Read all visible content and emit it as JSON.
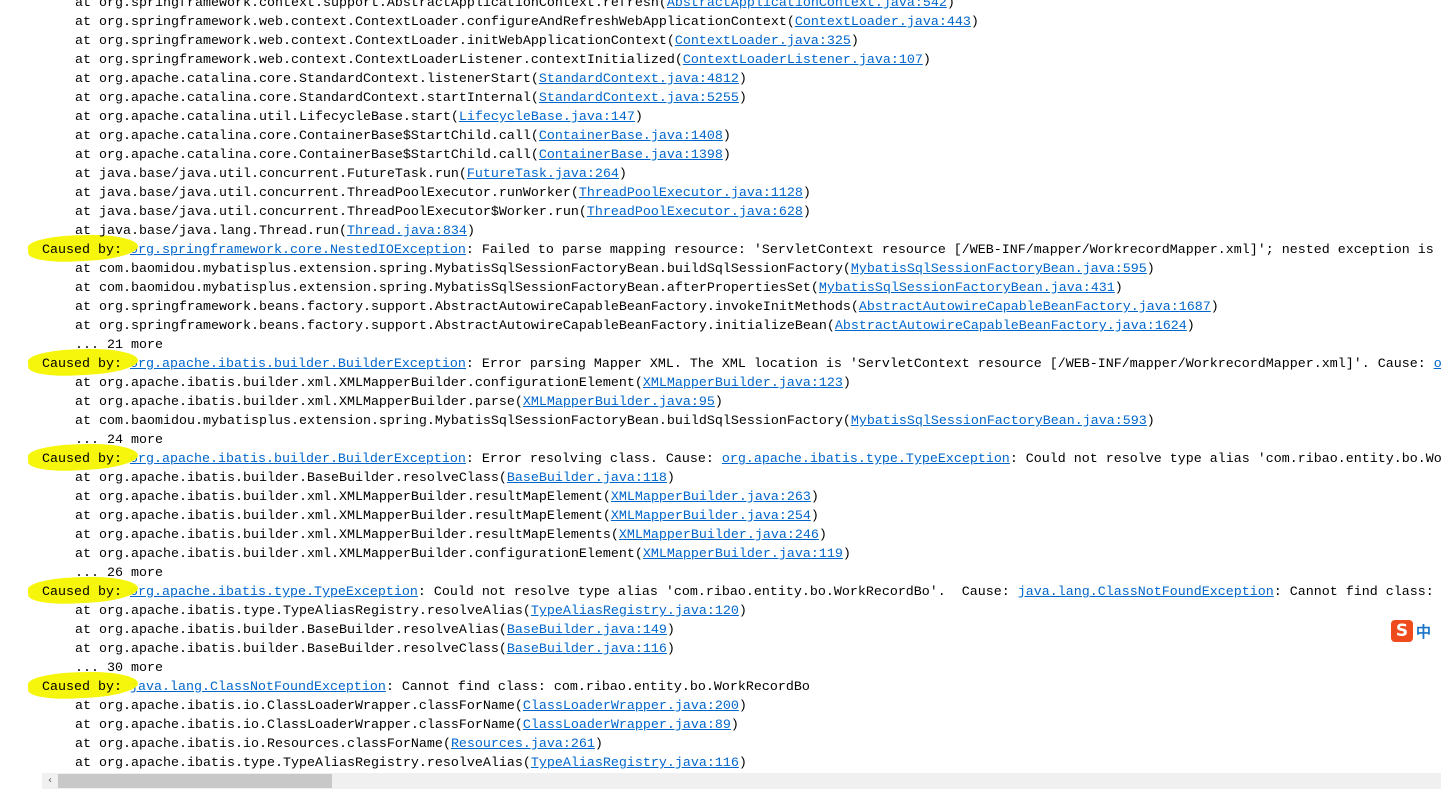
{
  "labels": {
    "at": "at ",
    "caused": "Caused by: "
  },
  "lines": [
    {
      "k": "at",
      "m": "org.springframework.context.support.AbstractApplicationContext.refresh",
      "src": "AbstractApplicationContext.java:542"
    },
    {
      "k": "at",
      "m": "org.springframework.web.context.ContextLoader.configureAndRefreshWebApplicationContext",
      "src": "ContextLoader.java:443"
    },
    {
      "k": "at",
      "m": "org.springframework.web.context.ContextLoader.initWebApplicationContext",
      "src": "ContextLoader.java:325"
    },
    {
      "k": "at",
      "m": "org.springframework.web.context.ContextLoaderListener.contextInitialized",
      "src": "ContextLoaderListener.java:107"
    },
    {
      "k": "at",
      "m": "org.apache.catalina.core.StandardContext.listenerStart",
      "src": "StandardContext.java:4812"
    },
    {
      "k": "at",
      "m": "org.apache.catalina.core.StandardContext.startInternal",
      "src": "StandardContext.java:5255"
    },
    {
      "k": "at",
      "m": "org.apache.catalina.util.LifecycleBase.start",
      "src": "LifecycleBase.java:147"
    },
    {
      "k": "at",
      "m": "org.apache.catalina.core.ContainerBase$StartChild.call",
      "src": "ContainerBase.java:1408"
    },
    {
      "k": "at",
      "m": "org.apache.catalina.core.ContainerBase$StartChild.call",
      "src": "ContainerBase.java:1398"
    },
    {
      "k": "at",
      "m": "java.base/java.util.concurrent.FutureTask.run",
      "src": "FutureTask.java:264"
    },
    {
      "k": "at",
      "m": "java.base/java.util.concurrent.ThreadPoolExecutor.runWorker",
      "src": "ThreadPoolExecutor.java:1128"
    },
    {
      "k": "at",
      "m": "java.base/java.util.concurrent.ThreadPoolExecutor$Worker.run",
      "src": "ThreadPoolExecutor.java:628"
    },
    {
      "k": "at",
      "m": "java.base/java.lang.Thread.run",
      "src": "Thread.java:834"
    },
    {
      "k": "caused",
      "segs": [
        {
          "t": "org.springframework.core.NestedIOException",
          "l": true
        },
        {
          "t": ": Failed to parse mapping resource: 'ServletContext resource [/WEB-INF/mapper/WorkrecordMapper.xml]'; nested exception is"
        }
      ]
    },
    {
      "k": "at",
      "m": "com.baomidou.mybatisplus.extension.spring.MybatisSqlSessionFactoryBean.buildSqlSessionFactory",
      "src": "MybatisSqlSessionFactoryBean.java:595"
    },
    {
      "k": "at",
      "m": "com.baomidou.mybatisplus.extension.spring.MybatisSqlSessionFactoryBean.afterPropertiesSet",
      "src": "MybatisSqlSessionFactoryBean.java:431"
    },
    {
      "k": "at",
      "m": "org.springframework.beans.factory.support.AbstractAutowireCapableBeanFactory.invokeInitMethods",
      "src": "AbstractAutowireCapableBeanFactory.java:1687"
    },
    {
      "k": "at",
      "m": "org.springframework.beans.factory.support.AbstractAutowireCapableBeanFactory.initializeBean",
      "src": "AbstractAutowireCapableBeanFactory.java:1624"
    },
    {
      "k": "more",
      "t": "... 21 more"
    },
    {
      "k": "caused",
      "segs": [
        {
          "t": "org.apache.ibatis.builder.BuilderException",
          "l": true
        },
        {
          "t": ": Error parsing Mapper XML. The XML location is 'ServletContext resource [/WEB-INF/mapper/WorkrecordMapper.xml]'. Cause: "
        },
        {
          "t": "o",
          "l": true
        }
      ]
    },
    {
      "k": "at",
      "m": "org.apache.ibatis.builder.xml.XMLMapperBuilder.configurationElement",
      "src": "XMLMapperBuilder.java:123"
    },
    {
      "k": "at",
      "m": "org.apache.ibatis.builder.xml.XMLMapperBuilder.parse",
      "src": "XMLMapperBuilder.java:95"
    },
    {
      "k": "at",
      "m": "com.baomidou.mybatisplus.extension.spring.MybatisSqlSessionFactoryBean.buildSqlSessionFactory",
      "src": "MybatisSqlSessionFactoryBean.java:593"
    },
    {
      "k": "more",
      "t": "... 24 more"
    },
    {
      "k": "caused",
      "segs": [
        {
          "t": "org.apache.ibatis.builder.BuilderException",
          "l": true
        },
        {
          "t": ": Error resolving class. Cause: "
        },
        {
          "t": "org.apache.ibatis.type.TypeException",
          "l": true
        },
        {
          "t": ": Could not resolve type alias 'com.ribao.entity.bo.Wo"
        }
      ]
    },
    {
      "k": "at",
      "m": "org.apache.ibatis.builder.BaseBuilder.resolveClass",
      "src": "BaseBuilder.java:118"
    },
    {
      "k": "at",
      "m": "org.apache.ibatis.builder.xml.XMLMapperBuilder.resultMapElement",
      "src": "XMLMapperBuilder.java:263"
    },
    {
      "k": "at",
      "m": "org.apache.ibatis.builder.xml.XMLMapperBuilder.resultMapElement",
      "src": "XMLMapperBuilder.java:254"
    },
    {
      "k": "at",
      "m": "org.apache.ibatis.builder.xml.XMLMapperBuilder.resultMapElements",
      "src": "XMLMapperBuilder.java:246"
    },
    {
      "k": "at",
      "m": "org.apache.ibatis.builder.xml.XMLMapperBuilder.configurationElement",
      "src": "XMLMapperBuilder.java:119"
    },
    {
      "k": "more",
      "t": "... 26 more"
    },
    {
      "k": "caused",
      "segs": [
        {
          "t": "org.apache.ibatis.type.TypeException",
          "l": true
        },
        {
          "t": ": Could not resolve type alias 'com.ribao.entity.bo.WorkRecordBo'.  Cause: "
        },
        {
          "t": "java.lang.ClassNotFoundException",
          "l": true
        },
        {
          "t": ": Cannot find class:"
        }
      ]
    },
    {
      "k": "at",
      "m": "org.apache.ibatis.type.TypeAliasRegistry.resolveAlias",
      "src": "TypeAliasRegistry.java:120"
    },
    {
      "k": "at",
      "m": "org.apache.ibatis.builder.BaseBuilder.resolveAlias",
      "src": "BaseBuilder.java:149"
    },
    {
      "k": "at",
      "m": "org.apache.ibatis.builder.BaseBuilder.resolveClass",
      "src": "BaseBuilder.java:116"
    },
    {
      "k": "more",
      "t": "... 30 more"
    },
    {
      "k": "caused",
      "segs": [
        {
          "t": "java.lang.ClassNotFoundException",
          "l": true
        },
        {
          "t": ": Cannot find class: com.ribao.entity.bo.WorkRecordBo"
        }
      ]
    },
    {
      "k": "at",
      "m": "org.apache.ibatis.io.ClassLoaderWrapper.classForName",
      "src": "ClassLoaderWrapper.java:200"
    },
    {
      "k": "at",
      "m": "org.apache.ibatis.io.ClassLoaderWrapper.classForName",
      "src": "ClassLoaderWrapper.java:89"
    },
    {
      "k": "at",
      "m": "org.apache.ibatis.io.Resources.classForName",
      "src": "Resources.java:261"
    },
    {
      "k": "at",
      "m": "org.apache.ibatis.type.TypeAliasRegistry.resolveAlias",
      "src": "TypeAliasRegistry.java:116"
    }
  ],
  "scrollbar": {
    "left_arrow": "‹",
    "position": 0.0
  },
  "ime": {
    "logo": "S",
    "mode": "中"
  },
  "colors": {
    "link": "#0066cc",
    "highlight": "#f5f500",
    "ime": "#f04b1c"
  }
}
